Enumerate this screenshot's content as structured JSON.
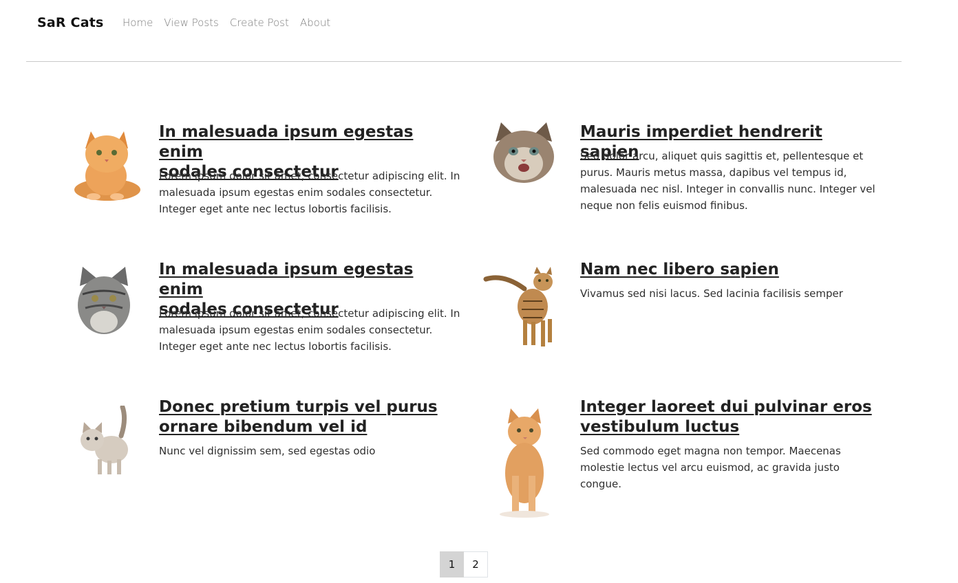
{
  "nav": {
    "brand": "SaR Cats",
    "links": [
      "Home",
      "View Posts",
      "Create Post",
      "About"
    ]
  },
  "posts": [
    {
      "title_line1": "In malesuada ipsum egestas enim",
      "title_line2": "sodales consectetur",
      "excerpt_lines": [
        "Lorem ipsum dolor sit amet, consectetur adipiscing elit. In",
        "malesuada ipsum egestas enim sodales consectetur.",
        "Integer eget ante nec lectus lobortis facilisis."
      ],
      "image": "orange-kitten-lying-photo"
    },
    {
      "title_line1": "Mauris imperdiet hendrerit sapien",
      "title_line2": "",
      "excerpt_lines": [
        "Sed dolor arcu, aliquet quis sagittis et, pellentesque et",
        "purus. Mauris metus massa, dapibus vel tempus id,",
        "malesuada nec nisl. Integer in convallis nunc. Integer vel",
        "neque non felis euismod finibus."
      ],
      "image": "fluffy-kitten-face-photo"
    },
    {
      "title_line1": "In malesuada ipsum egestas enim",
      "title_line2": "sodales consectetur",
      "excerpt_lines": [
        "Lorem ipsum dolor sit amet, consectetur adipiscing elit. In",
        "malesuada ipsum egestas enim sodales consectetur.",
        "Integer eget ante nec lectus lobortis facilisis."
      ],
      "image": "grey-tabby-cat-photo"
    },
    {
      "title_line1": "Nam nec libero sapien",
      "title_line2": "",
      "excerpt_lines": [
        "Vivamus sed nisi lacus. Sed lacinia facilisis semper"
      ],
      "image": "bengal-cat-standing-photo"
    },
    {
      "title_line1": "Donec pretium turpis vel purus",
      "title_line2": "ornare bibendum vel id",
      "excerpt_lines": [
        "Nunc vel dignissim sem, sed egestas odio"
      ],
      "image": "tabby-kitten-walking-photo"
    },
    {
      "title_line1": "Integer laoreet dui pulvinar eros",
      "title_line2": "vestibulum luctus",
      "excerpt_lines": [
        "Sed commodo eget magna non tempor. Maecenas",
        "molestie lectus vel arcu euismod, ac gravida justo congue."
      ],
      "image": "ginger-kitten-sitting-photo"
    }
  ],
  "pagination": {
    "pages": [
      "1",
      "2"
    ],
    "active": "1"
  }
}
